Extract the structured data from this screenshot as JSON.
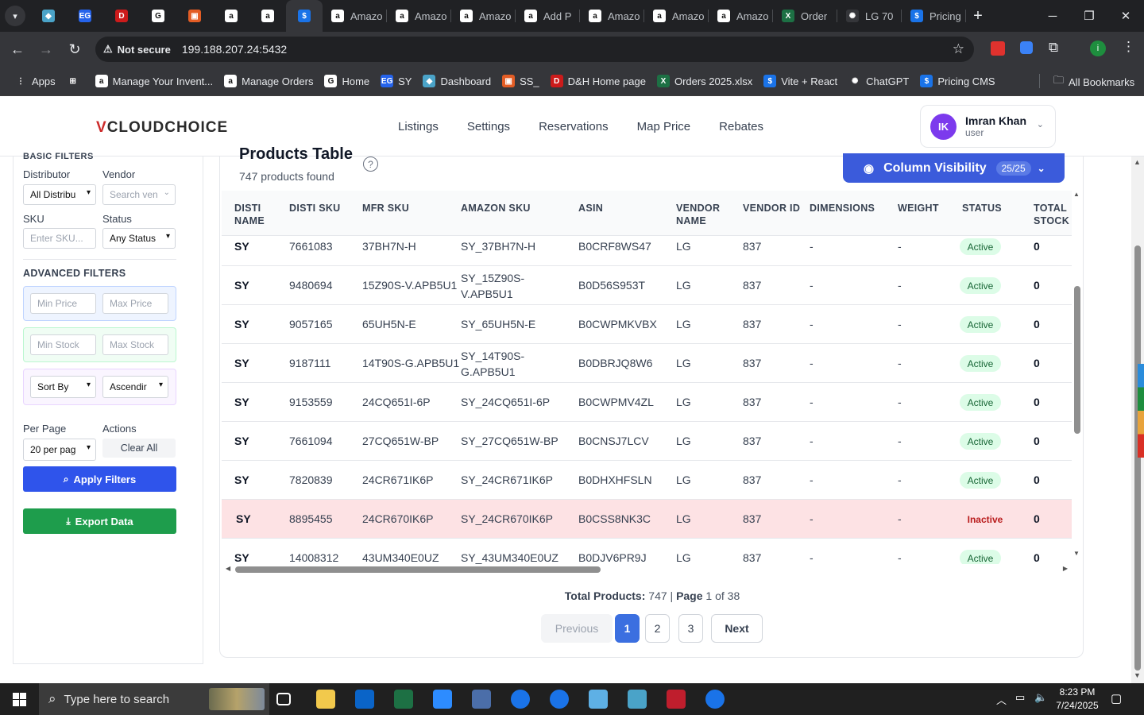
{
  "browser": {
    "pinned_tabs": [
      {
        "icon": "diamond-icon",
        "color": "#4aa3c8"
      },
      {
        "icon": "eg-icon",
        "color": "#2563eb"
      },
      {
        "icon": "dh-icon",
        "color": "#cc1b1b"
      },
      {
        "icon": "g-icon",
        "color": "#ffffff"
      },
      {
        "icon": "box-icon",
        "color": "#e35d25"
      },
      {
        "icon": "amazon-icon",
        "color": "#ffffff"
      },
      {
        "icon": "amazon-icon",
        "color": "#ffffff"
      },
      {
        "icon": "dollar-icon",
        "color": "#1a73e8"
      }
    ],
    "tabs": [
      {
        "title": "Amazo",
        "icon": "amazon-icon"
      },
      {
        "title": "Amazo",
        "icon": "amazon-icon"
      },
      {
        "title": "Amazo",
        "icon": "amazon-icon"
      },
      {
        "title": "Add P",
        "icon": "amazon-icon"
      },
      {
        "title": "Amazo",
        "icon": "amazon-icon"
      },
      {
        "title": "Amazo",
        "icon": "amazon-icon"
      },
      {
        "title": "Amazo",
        "icon": "amazon-icon"
      },
      {
        "title": "Order",
        "icon": "excel-icon"
      },
      {
        "title": "LG 70",
        "icon": "chatgpt-icon"
      },
      {
        "title": "Pricing",
        "icon": "dollar-icon"
      }
    ],
    "not_secure": "Not secure",
    "url": "199.188.207.24:5432",
    "bookmarks": [
      {
        "label": "Apps",
        "icon": "apps-icon"
      },
      {
        "label": "",
        "icon": "grid-icon"
      },
      {
        "label": "Manage Your Invent...",
        "icon": "amazon-icon"
      },
      {
        "label": "Manage Orders",
        "icon": "amazon-icon"
      },
      {
        "label": "Home",
        "icon": "g-icon"
      },
      {
        "label": "SY",
        "icon": "eg-icon"
      },
      {
        "label": "Dashboard",
        "icon": "diamond-icon"
      },
      {
        "label": "SS_",
        "icon": "box-icon"
      },
      {
        "label": "D&H Home page",
        "icon": "dh-icon"
      },
      {
        "label": "Orders 2025.xlsx",
        "icon": "excel-icon"
      },
      {
        "label": "Vite + React",
        "icon": "dollar-icon"
      },
      {
        "label": "ChatGPT",
        "icon": "chatgpt-icon"
      },
      {
        "label": "Pricing CMS",
        "icon": "dollar-icon"
      }
    ],
    "all_bookmarks": "All Bookmarks"
  },
  "header": {
    "logo_prefix": "V",
    "logo_text": "CLOUDCHOICE",
    "nav": [
      "Listings",
      "Settings",
      "Reservations",
      "Map Price",
      "Rebates"
    ],
    "user_initials": "IK",
    "user_name": "Imran Khan",
    "user_role": "user"
  },
  "filters": {
    "basic_heading": "BASIC FILTERS",
    "distributor_label": "Distributor",
    "distributor_value": "All Distribu",
    "vendor_label": "Vendor",
    "vendor_placeholder": "Search ven",
    "sku_label": "SKU",
    "sku_placeholder": "Enter SKU...",
    "status_label": "Status",
    "status_value": "Any Status",
    "advanced_heading": "ADVANCED FILTERS",
    "min_price_placeholder": "Min Price",
    "max_price_placeholder": "Max Price",
    "min_stock_placeholder": "Min Stock",
    "max_stock_placeholder": "Max Stock",
    "sort_by_value": "Sort By",
    "order_value": "Ascendir",
    "per_page_label": "Per Page",
    "per_page_value": "20 per pag",
    "actions_label": "Actions",
    "clear_all": "Clear All",
    "apply_filters": "Apply Filters",
    "export_data": "Export Data"
  },
  "products": {
    "title": "Products Table",
    "count": "747 products found",
    "column_visibility": "Column Visibility",
    "column_visibility_count": "25/25",
    "columns": [
      "DISTI NAME",
      "DISTI SKU",
      "MFR SKU",
      "AMAZON SKU",
      "ASIN",
      "VENDOR NAME",
      "VENDOR ID",
      "DIMENSIONS",
      "WEIGHT",
      "STATUS",
      "TOTAL STOCK"
    ],
    "rows": [
      {
        "disti": "SY",
        "disti_sku": "7661083",
        "mfr_sku": "37BH7N-H",
        "amazon_sku": "SY_37BH7N-H",
        "asin": "B0CRF8WS47",
        "vendor": "LG",
        "vendor_id": "837",
        "dimensions": "-",
        "weight": "-",
        "status": "Active",
        "stock": "0"
      },
      {
        "disti": "SY",
        "disti_sku": "9480694",
        "mfr_sku": "15Z90S-V.APB5U1",
        "amazon_sku": "SY_15Z90S-V.APB5U1",
        "asin": "B0D56S953T",
        "vendor": "LG",
        "vendor_id": "837",
        "dimensions": "-",
        "weight": "-",
        "status": "Active",
        "stock": "0"
      },
      {
        "disti": "SY",
        "disti_sku": "9057165",
        "mfr_sku": "65UH5N-E",
        "amazon_sku": "SY_65UH5N-E",
        "asin": "B0CWPMKVBX",
        "vendor": "LG",
        "vendor_id": "837",
        "dimensions": "-",
        "weight": "-",
        "status": "Active",
        "stock": "0"
      },
      {
        "disti": "SY",
        "disti_sku": "9187111",
        "mfr_sku": "14T90S-G.APB5U1",
        "amazon_sku": "SY_14T90S-G.APB5U1",
        "asin": "B0DBRJQ8W6",
        "vendor": "LG",
        "vendor_id": "837",
        "dimensions": "-",
        "weight": "-",
        "status": "Active",
        "stock": "0"
      },
      {
        "disti": "SY",
        "disti_sku": "9153559",
        "mfr_sku": "24CQ651I-6P",
        "amazon_sku": "SY_24CQ651I-6P",
        "asin": "B0CWPMV4ZL",
        "vendor": "LG",
        "vendor_id": "837",
        "dimensions": "-",
        "weight": "-",
        "status": "Active",
        "stock": "0"
      },
      {
        "disti": "SY",
        "disti_sku": "7661094",
        "mfr_sku": "27CQ651W-BP",
        "amazon_sku": "SY_27CQ651W-BP",
        "asin": "B0CNSJ7LCV",
        "vendor": "LG",
        "vendor_id": "837",
        "dimensions": "-",
        "weight": "-",
        "status": "Active",
        "stock": "0"
      },
      {
        "disti": "SY",
        "disti_sku": "7820839",
        "mfr_sku": "24CR671IK6P",
        "amazon_sku": "SY_24CR671IK6P",
        "asin": "B0DHXHFSLN",
        "vendor": "LG",
        "vendor_id": "837",
        "dimensions": "-",
        "weight": "-",
        "status": "Active",
        "stock": "0"
      },
      {
        "disti": "SY",
        "disti_sku": "8895455",
        "mfr_sku": "24CR670IK6P",
        "amazon_sku": "SY_24CR670IK6P",
        "asin": "B0CSS8NK3C",
        "vendor": "LG",
        "vendor_id": "837",
        "dimensions": "-",
        "weight": "-",
        "status": "Inactive",
        "stock": "0"
      },
      {
        "disti": "SY",
        "disti_sku": "14008312",
        "mfr_sku": "43UM340E0UZ",
        "amazon_sku": "SY_43UM340E0UZ",
        "asin": "B0DJV6PR9J",
        "vendor": "LG",
        "vendor_id": "837",
        "dimensions": "-",
        "weight": "-",
        "status": "Active",
        "stock": "0"
      }
    ],
    "totals_prefix": "Total Products:",
    "totals_count": "747",
    "totals_page_label": "Page",
    "totals_page": "1 of 38",
    "pagination": {
      "previous": "Previous",
      "pages": [
        "1",
        "2",
        "3"
      ],
      "next": "Next",
      "current": "1"
    }
  },
  "taskbar": {
    "search_placeholder": "Type here to search",
    "apps": [
      {
        "icon": "task-view-icon",
        "color": "#202020"
      },
      {
        "icon": "file-explorer-icon",
        "color": "#f2c94c"
      },
      {
        "icon": "outlook-icon",
        "color": "#0a64c8"
      },
      {
        "icon": "excel-icon",
        "color": "#1d7044"
      },
      {
        "icon": "zoom-icon",
        "color": "#2d8cff"
      },
      {
        "icon": "calculator-icon",
        "color": "#4b6ea9"
      },
      {
        "icon": "chrome-icon",
        "color": "#1a73e8"
      },
      {
        "icon": "chrome-icon",
        "color": "#1a73e8"
      },
      {
        "icon": "notepad-icon",
        "color": "#5eb0e5"
      },
      {
        "icon": "diamond-icon",
        "color": "#4aa3c8"
      },
      {
        "icon": "filezilla-icon",
        "color": "#bf1e2d"
      },
      {
        "icon": "chrome-profile-icon",
        "color": "#1a73e8"
      }
    ],
    "time": "8:23 PM",
    "date": "7/24/2025"
  }
}
